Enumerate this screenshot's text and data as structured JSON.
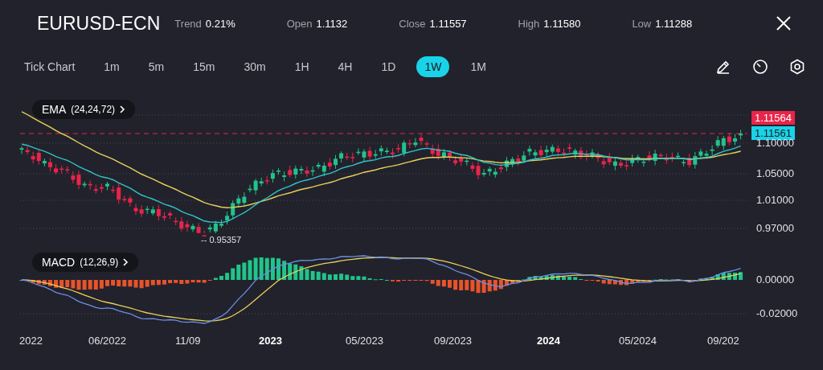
{
  "header": {
    "symbol": "EURUSD-ECN",
    "stats": [
      {
        "label": "Trend",
        "value": "0.21%"
      },
      {
        "label": "Open",
        "value": "1.1132"
      },
      {
        "label": "Close",
        "value": "1.11557"
      },
      {
        "label": "High",
        "value": "1.11580"
      },
      {
        "label": "Low",
        "value": "1.11288"
      }
    ]
  },
  "timeframes": [
    {
      "label": "Tick Chart",
      "selected": false
    },
    {
      "label": "1m",
      "selected": false
    },
    {
      "label": "5m",
      "selected": false
    },
    {
      "label": "15m",
      "selected": false
    },
    {
      "label": "30m",
      "selected": false
    },
    {
      "label": "1H",
      "selected": false
    },
    {
      "label": "4H",
      "selected": false
    },
    {
      "label": "1D",
      "selected": false
    },
    {
      "label": "1W",
      "selected": true
    },
    {
      "label": "1M",
      "selected": false
    }
  ],
  "price_chart": {
    "indicator": {
      "name": "EMA",
      "params": "(24,24,72)"
    },
    "axis_labels": [
      "1.10000",
      "1.05000",
      "1.01000",
      "0.97000"
    ],
    "price_tags": [
      {
        "value": "1.11564",
        "color": "#e8254a"
      },
      {
        "value": "1.11561",
        "color": "#19d3e8"
      }
    ],
    "low_label": "-- 0.95357"
  },
  "macd_chart": {
    "indicator": {
      "name": "MACD",
      "params": "(12,26,9)"
    },
    "axis_labels": [
      "0.00000",
      "-0.02000"
    ]
  },
  "time_axis": [
    {
      "label": "2022",
      "emphasis": false
    },
    {
      "label": "06/2022",
      "emphasis": false
    },
    {
      "label": "11/09",
      "emphasis": false
    },
    {
      "label": "2023",
      "emphasis": true
    },
    {
      "label": "05/2023",
      "emphasis": false
    },
    {
      "label": "09/2023",
      "emphasis": false
    },
    {
      "label": "2024",
      "emphasis": true
    },
    {
      "label": "05/2024",
      "emphasis": false
    },
    {
      "label": "09/202",
      "emphasis": false
    }
  ]
}
